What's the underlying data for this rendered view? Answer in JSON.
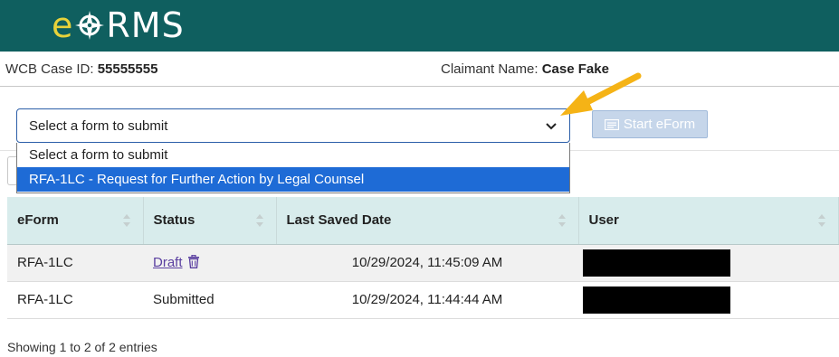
{
  "brand": {
    "logo_e": "e",
    "logo_rest": "RMS",
    "logo_full": "eFORMS",
    "header_color": "#0f5f5f",
    "logo_accent": "#e8d23a"
  },
  "case": {
    "id_label": "WCB Case ID:",
    "id_value": "55555555",
    "claimant_label": "Claimant Name:",
    "claimant_value": "Case Fake"
  },
  "form_select": {
    "selected": "Select a form to submit",
    "options": [
      "Select a form to submit",
      "RFA-1LC - Request for Further Action by Legal Counsel"
    ],
    "highlighted_index": 1
  },
  "start_button": {
    "label": "Start eForm",
    "icon": "form-icon"
  },
  "table": {
    "columns": [
      "eForm",
      "Status",
      "Last Saved Date",
      "User"
    ],
    "rows": [
      {
        "eform": "RFA-1LC",
        "status": "Draft",
        "status_link": true,
        "date": "10/29/2024, 11:45:09 AM",
        "user": "[redacted]"
      },
      {
        "eform": "RFA-1LC",
        "status": "Submitted",
        "status_link": false,
        "date": "10/29/2024, 11:44:44 AM",
        "user": "[redacted]"
      }
    ]
  },
  "footer": {
    "entries_text": "Showing 1 to 2 of 2 entries"
  },
  "annotation": {
    "arrow_color": "#f5b316"
  }
}
